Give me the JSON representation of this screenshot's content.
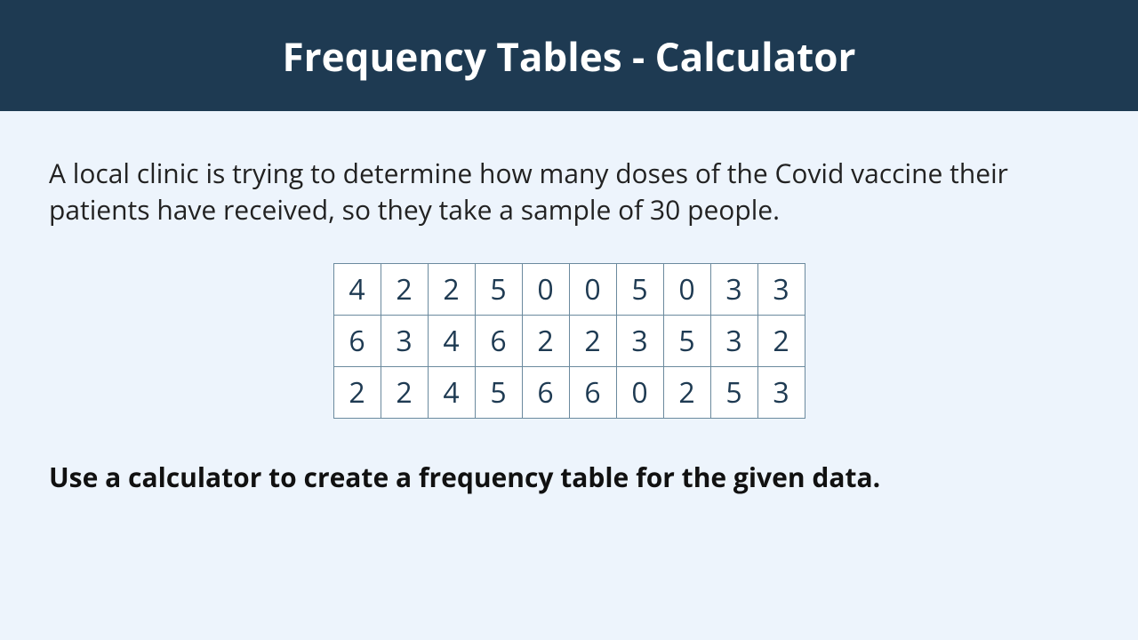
{
  "header": {
    "title": "Frequency Tables - Calculator"
  },
  "description": "A local clinic is trying to determine how many doses of the Covid vaccine their patients have received, so they take a sample of 30 people.",
  "data_grid": {
    "rows": [
      [
        "4",
        "2",
        "2",
        "5",
        "0",
        "0",
        "5",
        "0",
        "3",
        "3"
      ],
      [
        "6",
        "3",
        "4",
        "6",
        "2",
        "2",
        "3",
        "5",
        "3",
        "2"
      ],
      [
        "2",
        "2",
        "4",
        "5",
        "6",
        "6",
        "0",
        "2",
        "5",
        "3"
      ]
    ]
  },
  "instruction": "Use a calculator to create a frequency table for the given data."
}
